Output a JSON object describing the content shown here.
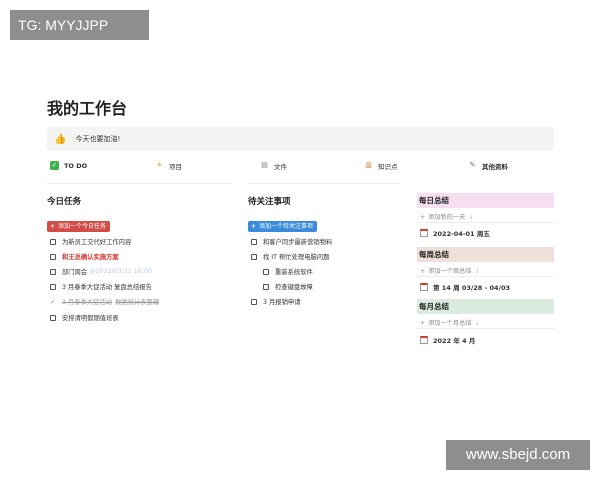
{
  "watermarks": {
    "top_left": "TG: MYYJJPP",
    "bottom_right": "www.sbejd.com"
  },
  "page": {
    "title": "我的工作台"
  },
  "callout": {
    "icon": "thumbs-up-icon",
    "text": "今天也要加油!"
  },
  "chips": [
    {
      "label": "TO DO",
      "icon": "checkbox-icon",
      "bg": "#d7e3ee",
      "icon_bg": "#3bb34a"
    },
    {
      "label": "项目",
      "icon": "sun-icon",
      "bg": "#fbf0cf",
      "icon_bg": "#fbf0cf"
    },
    {
      "label": "文件",
      "icon": "document-icon",
      "bg": "#e4e1f3",
      "icon_bg": "#e4e1f3"
    },
    {
      "label": "知识点",
      "icon": "book-icon",
      "bg": "#fae3cd",
      "icon_bg": "#fae3cd"
    },
    {
      "label": "其他资料",
      "icon": "notepad-icon",
      "bg": "#ece0f3",
      "icon_bg": "#ece0f3"
    }
  ],
  "today": {
    "title": "今日任务",
    "add_label": "添加一个今日任务",
    "add_color": "#d44c47",
    "items": [
      {
        "text": "为新员工交代好工作内容",
        "state": "open"
      },
      {
        "text": "和王总确认实施方案",
        "state": "open",
        "style": "red"
      },
      {
        "text": "部门周会",
        "mention": "@2022/03/31 16:00",
        "state": "open"
      },
      {
        "text": "3 月春季大促活动 复盘总结报告",
        "state": "open"
      },
      {
        "text": "3 月春季大促活动",
        "text2": "数据统计表整理",
        "state": "done"
      },
      {
        "text": "安排清明假期值班表",
        "state": "open"
      }
    ]
  },
  "watch": {
    "title": "待关注事项",
    "add_label": "添加一个待关注事项",
    "add_color": "#3a8bd9",
    "items": [
      {
        "text": "和客户同步最新营销物料",
        "indent": 0
      },
      {
        "text": "找 IT 帮忙处理电脑问题",
        "indent": 0
      },
      {
        "text": "重装系统软件",
        "indent": 1
      },
      {
        "text": "检查键盘故障",
        "indent": 1
      },
      {
        "text": "3 月报销申请",
        "indent": 0
      }
    ]
  },
  "summaries": [
    {
      "title": "每日总结",
      "bg": "#f5dff0",
      "add_label": "添加新的一天",
      "item": "2022-04-01 周五"
    },
    {
      "title": "每周总结",
      "bg": "#f1e0d9",
      "add_label": "添加一个周总结",
      "item": "第 14 周 03/28 - 04/03"
    },
    {
      "title": "每月总结",
      "bg": "#dcebe0",
      "add_label": "添加一个月总结",
      "item": "2022 年 4 月"
    }
  ]
}
